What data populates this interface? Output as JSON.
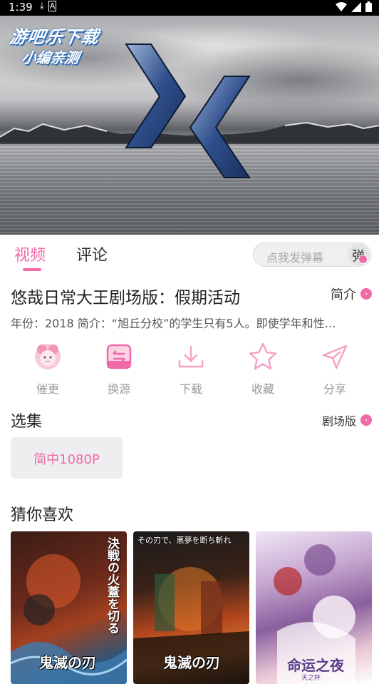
{
  "status_bar": {
    "time": "1:39",
    "left_icons": [
      "download-icon",
      "a-box-icon"
    ],
    "right_icons": [
      "wifi-icon",
      "signal-icon",
      "battery-icon"
    ]
  },
  "watermark": {
    "line1": "游吧乐下载",
    "line2": "小编亲测"
  },
  "tabs": [
    {
      "label": "视频",
      "active": true
    },
    {
      "label": "评论",
      "active": false
    }
  ],
  "danmaku": {
    "placeholder": "点我发弹幕",
    "button": "弹"
  },
  "video_info": {
    "title": "悠哉日常大王剧场版：假期活动",
    "intro_link": "简介",
    "meta": "年份：2018  简介：“旭丘分校”的学生只有5人。即使学年和性…"
  },
  "actions": [
    {
      "label": "催更",
      "icon": "avatar-icon"
    },
    {
      "label": "换源",
      "icon": "swap-icon"
    },
    {
      "label": "下载",
      "icon": "download-icon"
    },
    {
      "label": "收藏",
      "icon": "star-icon"
    },
    {
      "label": "分享",
      "icon": "share-icon"
    }
  ],
  "episodes": {
    "title": "选集",
    "link": "剧场版",
    "items": [
      {
        "label": "简中1080P"
      }
    ]
  },
  "recommend": {
    "title": "猜你喜欢",
    "posters": [
      {
        "vertical_text": "決戦の火蓋を切る",
        "logo": "鬼滅の刃"
      },
      {
        "vertical_text": "その刃で、悪夢を断ち斬れ",
        "logo": "鬼滅の刃"
      },
      {
        "logo": "命运之夜",
        "sub": "天之杯"
      }
    ]
  },
  "colors": {
    "accent": "#f06aa7",
    "inactive_text": "#999999"
  }
}
